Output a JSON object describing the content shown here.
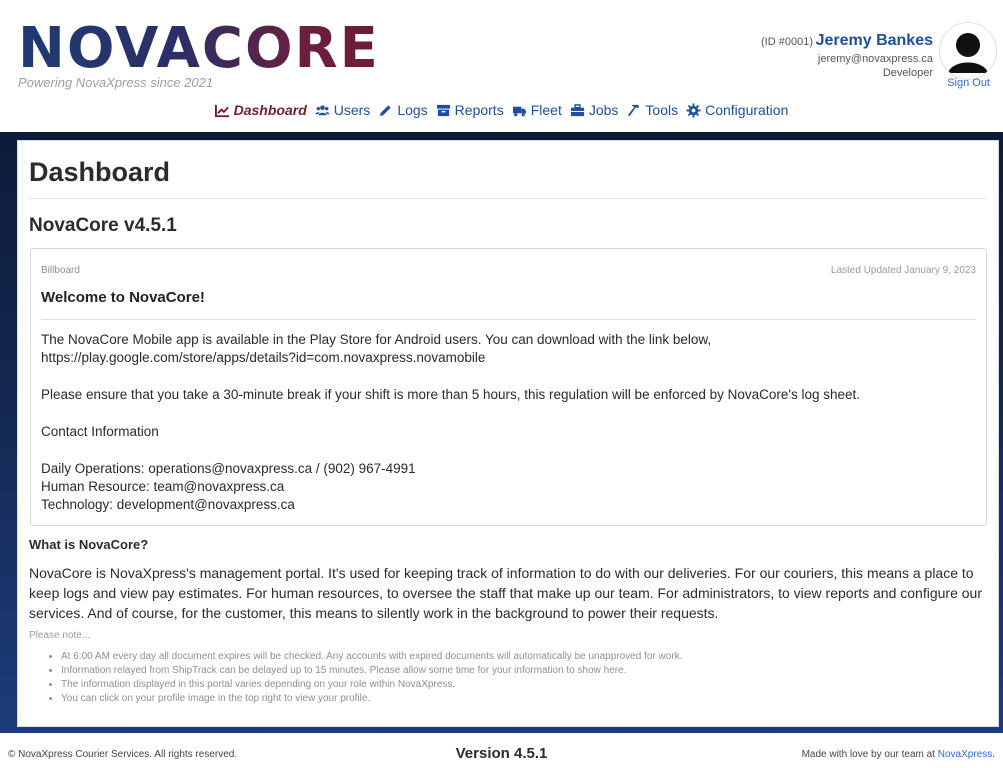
{
  "header": {
    "logo": "NOVACORE",
    "tagline": "Powering NovaXpress since 2021",
    "user": {
      "id": "(ID #0001)",
      "name": "Jeremy Bankes",
      "email": "jeremy@novaxpress.ca",
      "role": "Developer",
      "sign_out": "Sign Out"
    },
    "nav": [
      {
        "label": "Dashboard",
        "icon": "chart-line-icon",
        "active": true
      },
      {
        "label": "Users",
        "icon": "users-icon",
        "active": false
      },
      {
        "label": "Logs",
        "icon": "pencil-icon",
        "active": false
      },
      {
        "label": "Reports",
        "icon": "archive-icon",
        "active": false
      },
      {
        "label": "Fleet",
        "icon": "truck-icon",
        "active": false
      },
      {
        "label": "Jobs",
        "icon": "briefcase-icon",
        "active": false
      },
      {
        "label": "Tools",
        "icon": "hammer-icon",
        "active": false
      },
      {
        "label": "Configuration",
        "icon": "gear-icon",
        "active": false
      }
    ]
  },
  "main": {
    "title": "Dashboard",
    "subtitle": "NovaCore v4.5.1",
    "billboard": {
      "kicker": "Billboard",
      "updated": "Lasted Updated January 9, 2023",
      "heading": "Welcome to NovaCore!",
      "paragraphs": [
        "The NovaCore Mobile app is available in the Play Store for Android users. You can download with the link below,",
        "https://play.google.com/store/apps/details?id=com.novaxpress.novamobile",
        "Please ensure that you take a 30-minute break if your shift is more than 5 hours, this regulation will be enforced by NovaCore's log sheet.",
        "Contact Information",
        "Daily Operations: operations@novaxpress.ca / (902) 967-4991",
        "Human Resource: team@novaxpress.ca",
        "Technology: development@novaxpress.ca"
      ]
    },
    "what_is": {
      "heading": "What is NovaCore?",
      "text": "NovaCore is NovaXpress's management portal. It's used for keeping track of information to do with our deliveries. For our couriers, this means a place to keep logs and view pay estimates. For human resources, to oversee the staff that make up our team. For administrators, to view reports and configure our services. And of course, for the customer, this means to silently work in the background to power their requests."
    },
    "notes": {
      "label": "Please note...",
      "items": [
        "At 6:00 AM every day all document expires will be checked. Any accounts with expired documents will automatically be unapproved for work.",
        "Information relayed from ShipTrack can be delayed up to 15 minutes. Please allow some time for your information to show here.",
        "The information displayed in this portal varies depending on your role within NovaXpress.",
        "You can click on your profile image in the top right to view your profile."
      ]
    }
  },
  "footer": {
    "copyright": "© NovaXpress Courier Services. All rights reserved.",
    "version": "Version 4.5.1",
    "made_prefix": "Made with love by our team at ",
    "made_link": "NovaXpress",
    "made_suffix": "."
  },
  "colors": {
    "brand_blue": "#1f4fa3",
    "active_nav": "#7a1b2d",
    "band_dark": "#0d1c3a",
    "band_light": "#1d3c7a",
    "link": "#2f6bd6"
  }
}
